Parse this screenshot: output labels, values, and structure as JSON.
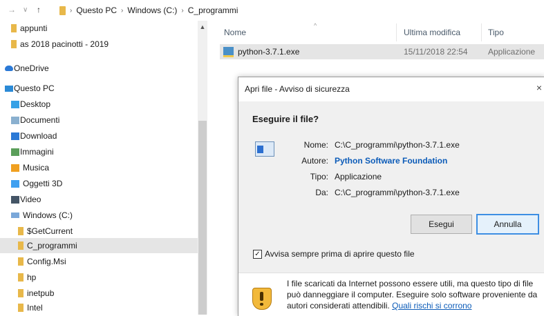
{
  "address": {
    "crumbs": [
      "Questo PC",
      "Windows (C:)",
      "C_programmi"
    ]
  },
  "tree": [
    {
      "label": "appunti",
      "icon": "folder-icon"
    },
    {
      "label": "as 2018 pacinotti - 2019",
      "icon": "folder-icon"
    },
    {
      "label": "OneDrive",
      "icon": "cloud-icon"
    },
    {
      "label": "Questo PC",
      "icon": "computer-icon"
    },
    {
      "label": "Desktop",
      "icon": "desktop-folder-icon"
    },
    {
      "label": "Documenti",
      "icon": "documents-folder-icon"
    },
    {
      "label": "Download",
      "icon": "download-folder-icon"
    },
    {
      "label": "Immagini",
      "icon": "pictures-folder-icon"
    },
    {
      "label": "Musica",
      "icon": "music-folder-icon"
    },
    {
      "label": "Oggetti 3D",
      "icon": "3d-objects-folder-icon"
    },
    {
      "label": "Video",
      "icon": "video-folder-icon"
    },
    {
      "label": "Windows (C:)",
      "icon": "drive-icon"
    },
    {
      "label": "$GetCurrent",
      "icon": "folder-icon"
    },
    {
      "label": "C_programmi",
      "icon": "folder-icon",
      "selected": true
    },
    {
      "label": "Config.Msi",
      "icon": "folder-icon"
    },
    {
      "label": "hp",
      "icon": "folder-icon"
    },
    {
      "label": "inetpub",
      "icon": "folder-icon"
    },
    {
      "label": "Intel",
      "icon": "folder-icon"
    }
  ],
  "columns": {
    "name": "Nome",
    "modified": "Ultima modifica",
    "type": "Tipo"
  },
  "file": {
    "name": "python-3.7.1.exe",
    "modified": "15/11/2018 22:54",
    "type": "Applicazione",
    "icon": "python-installer-icon"
  },
  "dialog": {
    "title": "Apri file - Avviso di sicurezza",
    "close": "×",
    "question": "Eseguire il file?",
    "name_label": "Nome:",
    "name_value": "C:\\C_programmi\\python-3.7.1.exe",
    "author_label": "Autore:",
    "author_value": "Python Software Foundation",
    "type_label": "Tipo:",
    "type_value": "Applicazione",
    "from_label": "Da:",
    "from_value": "C:\\C_programmi\\python-3.7.1.exe",
    "run_button": "Esegui",
    "cancel_button": "Annulla",
    "checkbox_label": "Avvisa sempre prima di aprire questo file",
    "checkbox_checked": true,
    "warning_text": "I file scaricati da Internet possono essere utili, ma questo tipo di file può danneggiare il computer. Eseguire solo software proveniente da autori considerati attendibili.",
    "warning_link": "Quali rischi si corrono"
  }
}
